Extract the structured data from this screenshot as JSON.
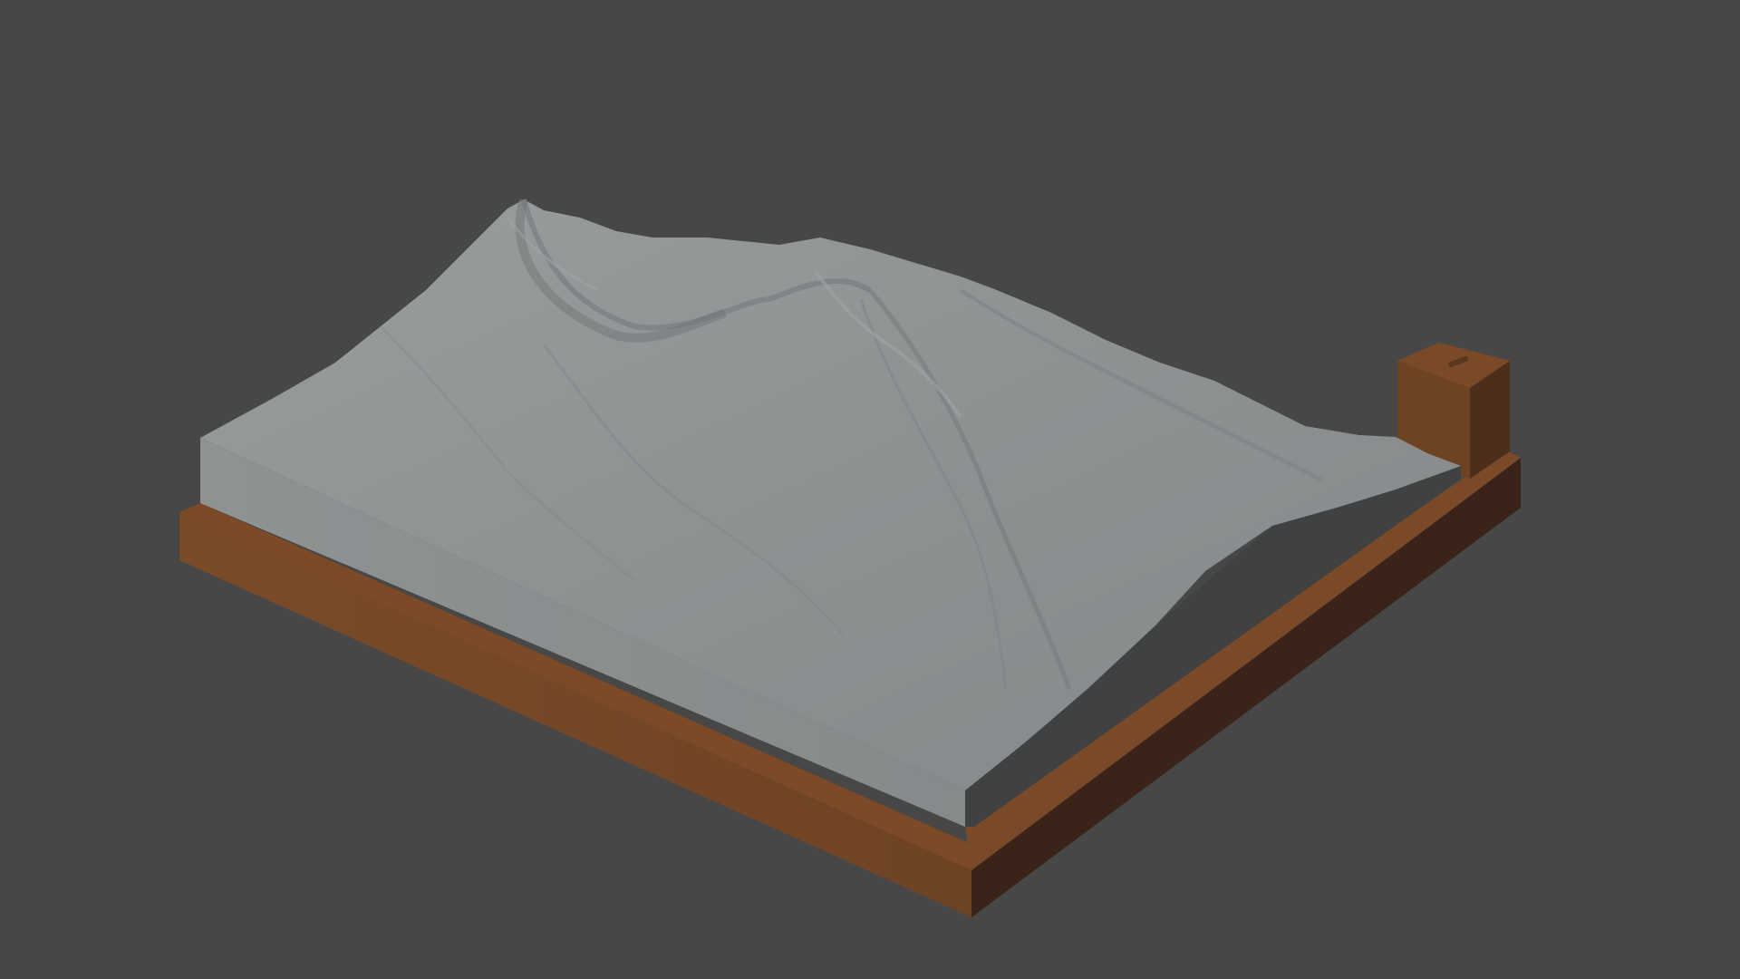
{
  "viewport": {
    "background_color": "#474747"
  },
  "model": {
    "terrain": {
      "surface_color": "#8f9293",
      "side_color": "#8a8d8e",
      "shadow_side_color": "#3f4142"
    },
    "base": {
      "front_color": "#734626",
      "top_color": "#7d4b28",
      "right_color": "#3a241a"
    },
    "label_block": {
      "front_color": "#6e4322",
      "side_color": "#4b2e1c",
      "top_color": "#7a4a28"
    }
  }
}
